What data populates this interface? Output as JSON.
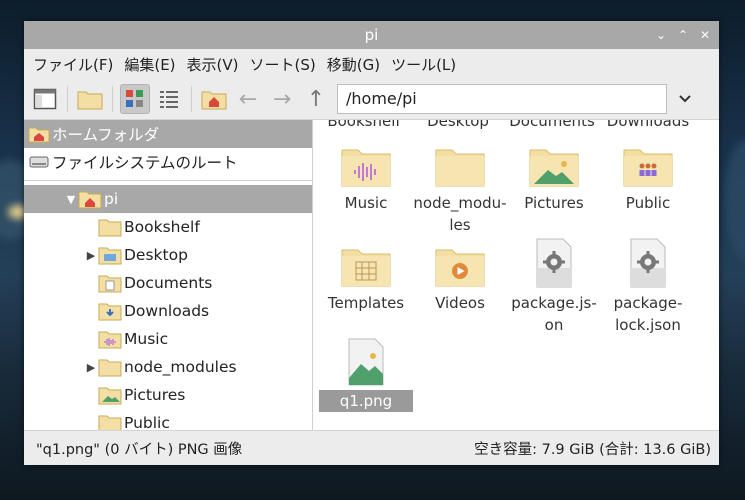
{
  "window": {
    "title": "pi"
  },
  "menubar": {
    "items": [
      {
        "label": "ファイル(F)"
      },
      {
        "label": "編集(E)"
      },
      {
        "label": "表示(V)"
      },
      {
        "label": "ソート(S)"
      },
      {
        "label": "移動(G)"
      },
      {
        "label": "ツール(L)"
      }
    ]
  },
  "toolbar": {
    "address": "/home/pi"
  },
  "places": [
    {
      "label": "ホームフォルダ",
      "icon": "home-folder-icon",
      "selected": true
    },
    {
      "label": "ファイルシステムのルート",
      "icon": "drive-icon",
      "selected": false
    }
  ],
  "tree": [
    {
      "label": "pi",
      "icon": "home-folder-icon",
      "expander": "▼",
      "selected": true
    },
    {
      "label": "Bookshelf",
      "icon": "folder-icon",
      "expander": ""
    },
    {
      "label": "Desktop",
      "icon": "desktop-folder-icon",
      "expander": "▶"
    },
    {
      "label": "Documents",
      "icon": "documents-folder-icon",
      "expander": ""
    },
    {
      "label": "Downloads",
      "icon": "downloads-folder-icon",
      "expander": ""
    },
    {
      "label": "Music",
      "icon": "music-folder-icon",
      "expander": ""
    },
    {
      "label": "node_modules",
      "icon": "folder-icon",
      "expander": "▶"
    },
    {
      "label": "Pictures",
      "icon": "pictures-folder-icon",
      "expander": ""
    },
    {
      "label": "Public",
      "icon": "folder-icon",
      "expander": ""
    }
  ],
  "files": {
    "partial_row": [
      "Bookshelf",
      "Desktop",
      "Documents",
      "Downloads"
    ],
    "items": [
      {
        "name": "Music",
        "icon": "music-folder-icon"
      },
      {
        "name": "node_modu-\nles",
        "icon": "folder-icon"
      },
      {
        "name": "Pictures",
        "icon": "pictures-folder-icon"
      },
      {
        "name": "Public",
        "icon": "public-folder-icon"
      },
      {
        "name": "Templates",
        "icon": "templates-folder-icon"
      },
      {
        "name": "Videos",
        "icon": "videos-folder-icon"
      },
      {
        "name": "package.js-\non",
        "icon": "json-file-icon"
      },
      {
        "name": "package-\nlock.json",
        "icon": "json-file-icon"
      },
      {
        "name": "q1.png",
        "icon": "image-file-icon",
        "selected": true
      }
    ]
  },
  "status": {
    "left": "\"q1.png\" (0 バイト) PNG 画像",
    "right": "空き容量: 7.9 GiB (合計: 13.6 GiB)"
  },
  "colors": {
    "folder": "#f3dfa3",
    "folder_dark": "#e8cd80",
    "home_red": "#d9483b",
    "selection": "#a8a8a8"
  }
}
